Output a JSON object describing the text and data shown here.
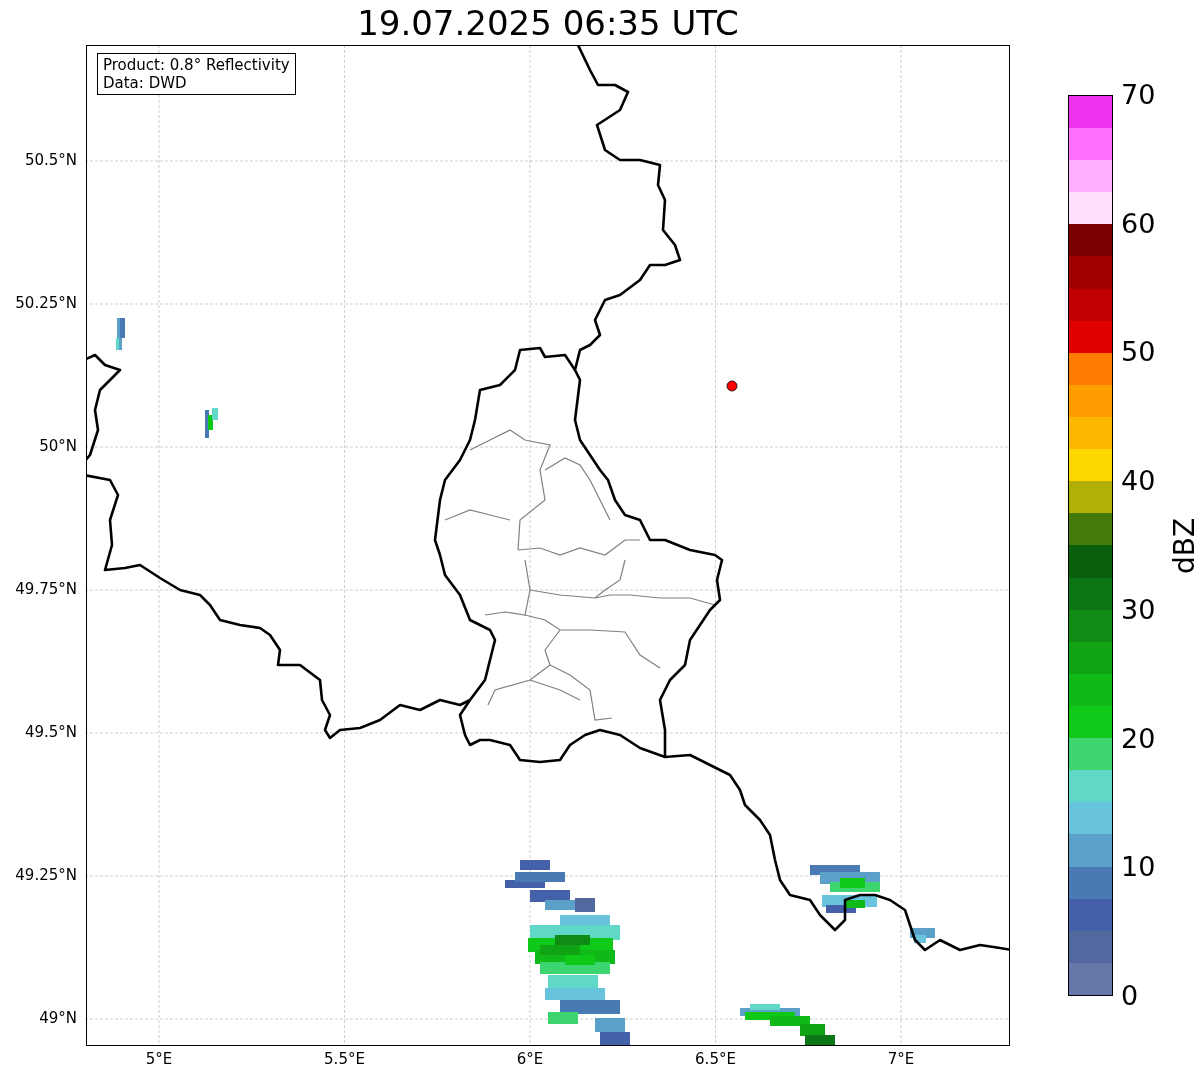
{
  "title": "19.07.2025 06:35 UTC",
  "info_box": {
    "lines": [
      "Product: 0.8° Reflectivity",
      "Data: DWD"
    ]
  },
  "map": {
    "xticks": [
      "5°E",
      "5.5°E",
      "6°E",
      "6.5°E",
      "7°E"
    ],
    "yticks": [
      "50.5°N",
      "50.25°N",
      "50°N",
      "49.75°N",
      "49.5°N",
      "49.25°N",
      "49°N"
    ]
  },
  "colorbar": {
    "label": "dBZ",
    "ticks": [
      "70",
      "60",
      "50",
      "40",
      "30",
      "20",
      "10",
      "0"
    ],
    "bands": [
      {
        "color": "#6677aa"
      },
      {
        "color": "#5468a0"
      },
      {
        "color": "#4460a8"
      },
      {
        "color": "#4a7ab4"
      },
      {
        "color": "#5aa0c8"
      },
      {
        "color": "#68c4dc"
      },
      {
        "color": "#60d8c8"
      },
      {
        "color": "#3dd56f"
      },
      {
        "color": "#10c818"
      },
      {
        "color": "#10b818"
      },
      {
        "color": "#10a414"
      },
      {
        "color": "#108c14"
      },
      {
        "color": "#0c7614"
      },
      {
        "color": "#08600c"
      },
      {
        "color": "#467a08"
      },
      {
        "color": "#b0b006"
      },
      {
        "color": "#ffd700"
      },
      {
        "color": "#ffb800"
      },
      {
        "color": "#ff9c00"
      },
      {
        "color": "#ff7c00"
      },
      {
        "color": "#e00000"
      },
      {
        "color": "#c00000"
      },
      {
        "color": "#a00000"
      },
      {
        "color": "#780000"
      },
      {
        "color": "#ffe0ff"
      },
      {
        "color": "#ffb0ff"
      },
      {
        "color": "#ff70ff"
      },
      {
        "color": "#ee33ee"
      }
    ]
  }
}
